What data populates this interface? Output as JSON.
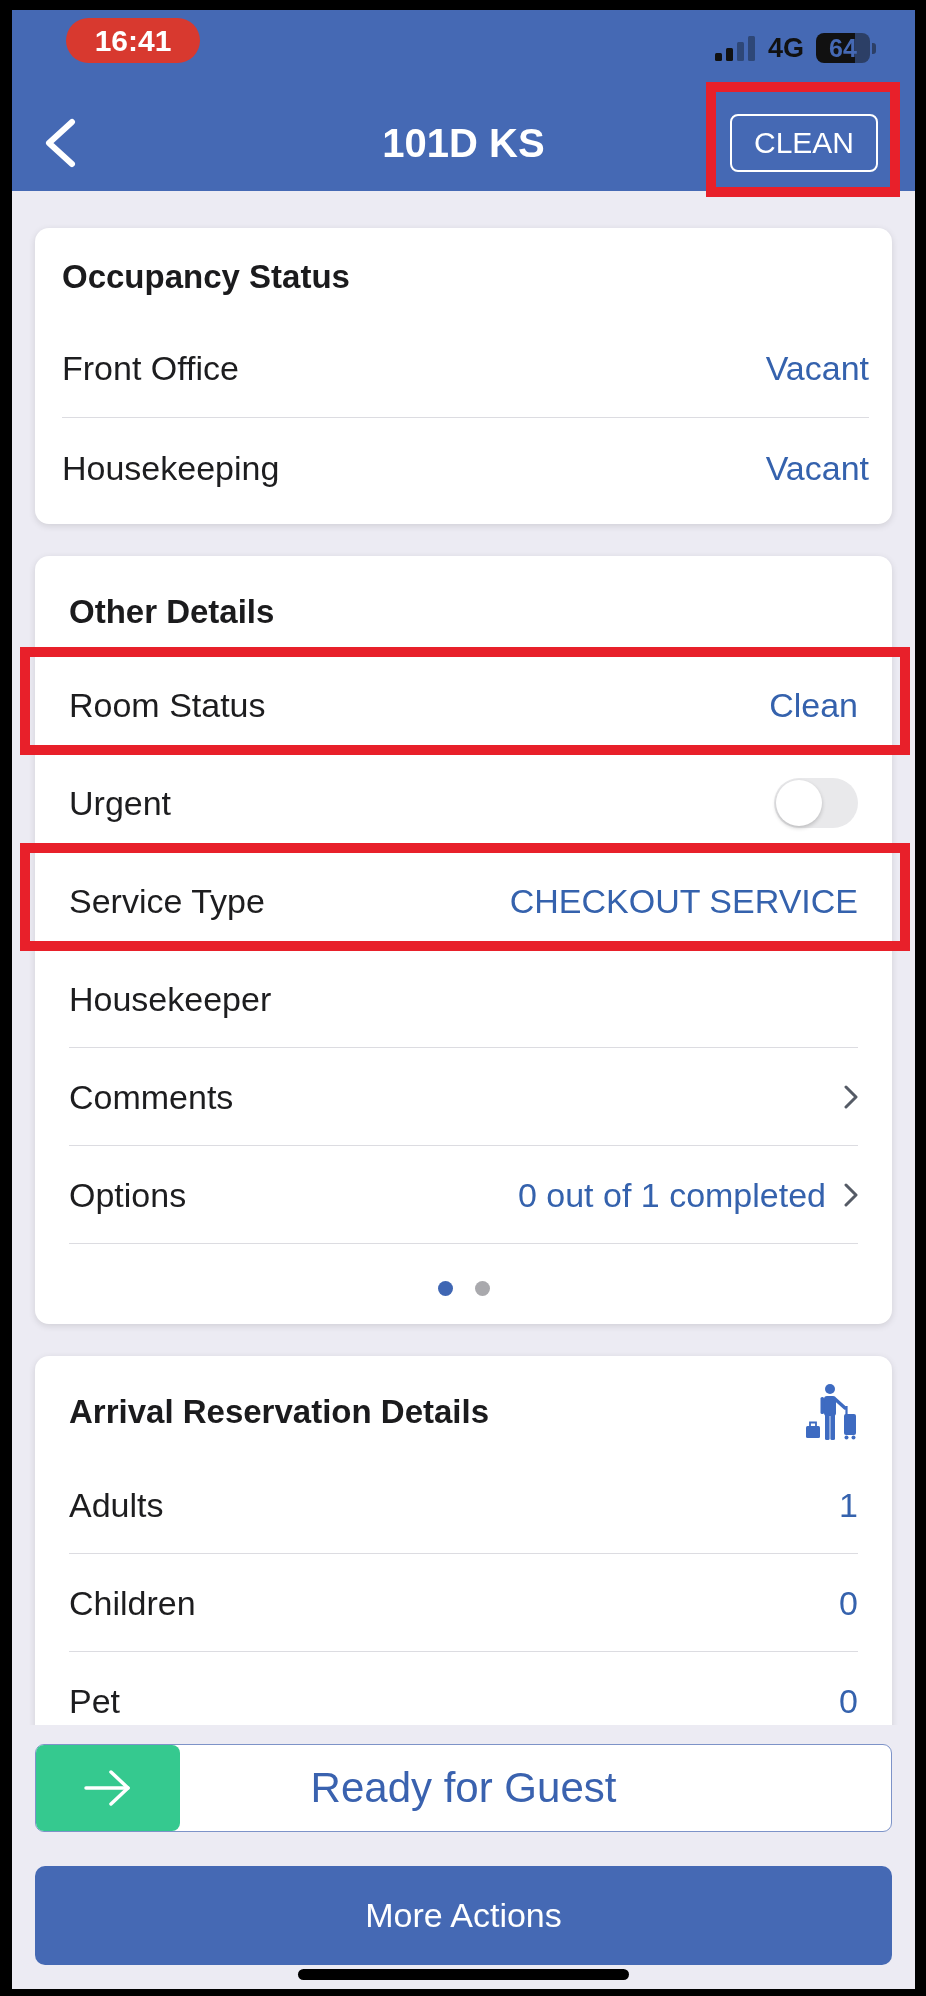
{
  "status_bar": {
    "time": "16:41",
    "network": "4G",
    "battery": "64"
  },
  "header": {
    "title": "101D KS",
    "action": {
      "label": "CLEAN",
      "highlighted": true
    }
  },
  "occupancy_status": {
    "title": "Occupancy Status",
    "rows": [
      {
        "kind": "value",
        "label": "Front Office",
        "value": "Vacant",
        "highlighted": false
      },
      {
        "kind": "value",
        "label": "Housekeeping",
        "value": "Vacant",
        "highlighted": false
      }
    ]
  },
  "other_details": {
    "title": "Other Details",
    "rows": [
      {
        "kind": "value",
        "label": "Room Status",
        "value": "Clean",
        "highlighted": true
      },
      {
        "kind": "toggle",
        "label": "Urgent",
        "on": false,
        "highlighted": false
      },
      {
        "kind": "value",
        "label": "Service Type",
        "value": "CHECKOUT SERVICE",
        "highlighted": true
      },
      {
        "kind": "value",
        "label": "Housekeeper",
        "highlighted": false
      },
      {
        "kind": "link",
        "label": "Comments",
        "highlighted": false
      },
      {
        "kind": "link",
        "label": "Options",
        "value": "0 out of 1 completed",
        "highlighted": false
      }
    ],
    "pages": [
      {
        "selected": true
      },
      {
        "selected": false
      }
    ]
  },
  "arrival_reservation_details": {
    "title": "Arrival Reservation Details",
    "rows": [
      {
        "kind": "value",
        "label": "Adults",
        "value": "1",
        "highlighted": false
      },
      {
        "kind": "value",
        "label": "Children",
        "value": "0",
        "highlighted": false
      },
      {
        "kind": "value",
        "label": "Pet",
        "value": "0",
        "highlighted": false
      }
    ]
  },
  "footer": {
    "swipe_button": {
      "label": "Ready for Guest"
    },
    "button": {
      "label": "More Actions"
    }
  }
}
